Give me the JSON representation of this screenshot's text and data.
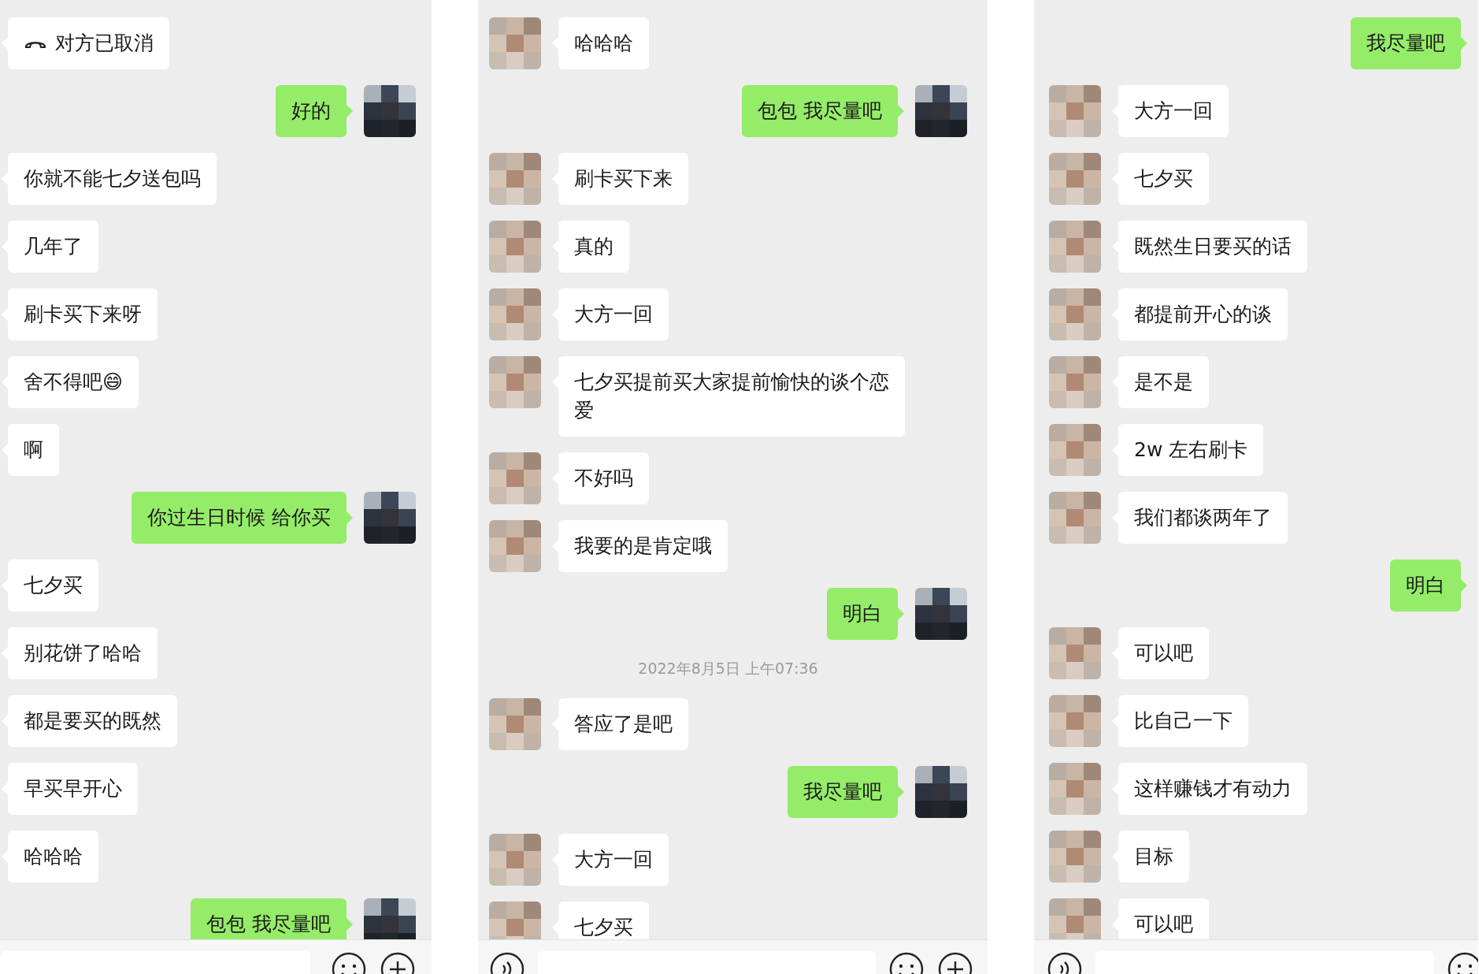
{
  "panels": [
    {
      "messages": [
        {
          "kind": "call",
          "text": "对方已取消"
        },
        {
          "kind": "sent",
          "avatar": true,
          "text": "好的"
        },
        {
          "kind": "received",
          "avatar": false,
          "text": "你就不能七夕送包吗"
        },
        {
          "kind": "received",
          "avatar": false,
          "text": "几年了"
        },
        {
          "kind": "received",
          "avatar": false,
          "text": "刷卡买下来呀"
        },
        {
          "kind": "received",
          "avatar": false,
          "text": "舍不得吧😄"
        },
        {
          "kind": "received",
          "avatar": false,
          "text": "啊"
        },
        {
          "kind": "sent",
          "avatar": true,
          "text": "你过生日时候 给你买"
        },
        {
          "kind": "received",
          "avatar": false,
          "text": "七夕买"
        },
        {
          "kind": "received",
          "avatar": false,
          "text": "别花饼了哈哈"
        },
        {
          "kind": "received",
          "avatar": false,
          "text": "都是要买的既然"
        },
        {
          "kind": "received",
          "avatar": false,
          "text": "早买早开心"
        },
        {
          "kind": "received",
          "avatar": false,
          "text": "哈哈哈"
        },
        {
          "kind": "sent",
          "avatar": true,
          "text": "包包 我尽量吧"
        }
      ],
      "input_bar": {
        "voice": false,
        "emoji": true,
        "plus": true
      }
    },
    {
      "messages": [
        {
          "kind": "received",
          "avatar": true,
          "text": "哈哈哈"
        },
        {
          "kind": "sent",
          "avatar": true,
          "text": "包包 我尽量吧"
        },
        {
          "kind": "received",
          "avatar": true,
          "text": "刷卡买下来"
        },
        {
          "kind": "received",
          "avatar": true,
          "text": "真的"
        },
        {
          "kind": "received",
          "avatar": true,
          "text": "大方一回"
        },
        {
          "kind": "received",
          "avatar": true,
          "text": "七夕买提前买大家提前愉快的谈个恋爱"
        },
        {
          "kind": "received",
          "avatar": true,
          "text": "不好吗"
        },
        {
          "kind": "received",
          "avatar": true,
          "text": "我要的是肯定哦"
        },
        {
          "kind": "sent",
          "avatar": true,
          "text": "明白"
        },
        {
          "kind": "time",
          "text": "2022年8月5日 上午07:36"
        },
        {
          "kind": "received",
          "avatar": true,
          "text": "答应了是吧"
        },
        {
          "kind": "sent",
          "avatar": true,
          "text": "我尽量吧"
        },
        {
          "kind": "received",
          "avatar": true,
          "text": "大方一回"
        },
        {
          "kind": "received",
          "avatar": true,
          "text": "七夕买"
        }
      ],
      "input_bar": {
        "voice": true,
        "emoji": true,
        "plus": true
      }
    },
    {
      "messages": [
        {
          "kind": "sent",
          "avatar": false,
          "text": "我尽量吧"
        },
        {
          "kind": "received",
          "avatar": true,
          "text": "大方一回"
        },
        {
          "kind": "received",
          "avatar": true,
          "text": "七夕买"
        },
        {
          "kind": "received",
          "avatar": true,
          "text": "既然生日要买的话"
        },
        {
          "kind": "received",
          "avatar": true,
          "text": "都提前开心的谈"
        },
        {
          "kind": "received",
          "avatar": true,
          "text": "是不是"
        },
        {
          "kind": "received",
          "avatar": true,
          "text": "2w 左右刷卡"
        },
        {
          "kind": "received",
          "avatar": true,
          "text": "我们都谈两年了"
        },
        {
          "kind": "sent",
          "avatar": false,
          "text": "明白"
        },
        {
          "kind": "received",
          "avatar": true,
          "text": "可以吧"
        },
        {
          "kind": "received",
          "avatar": true,
          "text": "比自己一下"
        },
        {
          "kind": "received",
          "avatar": true,
          "text": "这样赚钱才有动力"
        },
        {
          "kind": "received",
          "avatar": true,
          "text": "目标"
        },
        {
          "kind": "received",
          "avatar": true,
          "text": "可以吧"
        }
      ],
      "input_bar": {
        "voice": true,
        "emoji": true,
        "plus": false
      }
    }
  ]
}
